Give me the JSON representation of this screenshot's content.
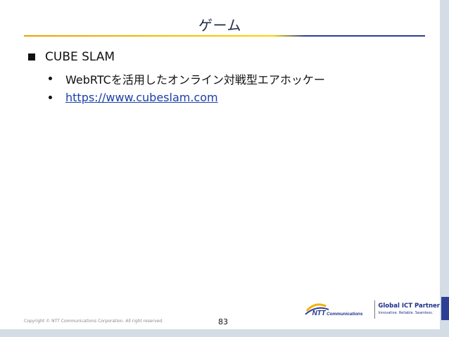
{
  "slide": {
    "title": "ゲーム",
    "bullet": "CUBE SLAM",
    "subbullets": [
      {
        "text": "WebRTCを活用したオンライン対戦型エアホッケー",
        "is_link": false
      },
      {
        "text": "https://www.cubeslam.com",
        "is_link": true
      }
    ]
  },
  "footer": {
    "copyright": "Copyright © NTT Communications Corporation. All right reserved.",
    "page_number": "83",
    "logo": {
      "brand": "NTT Communications",
      "partner_title": "Global ICT Partner",
      "tagline": "Innovative. Reliable. Seamless."
    }
  },
  "colors": {
    "accent_blue": "#2c3f95",
    "accent_gold": "#f2c200",
    "link": "#1a3fa8"
  }
}
